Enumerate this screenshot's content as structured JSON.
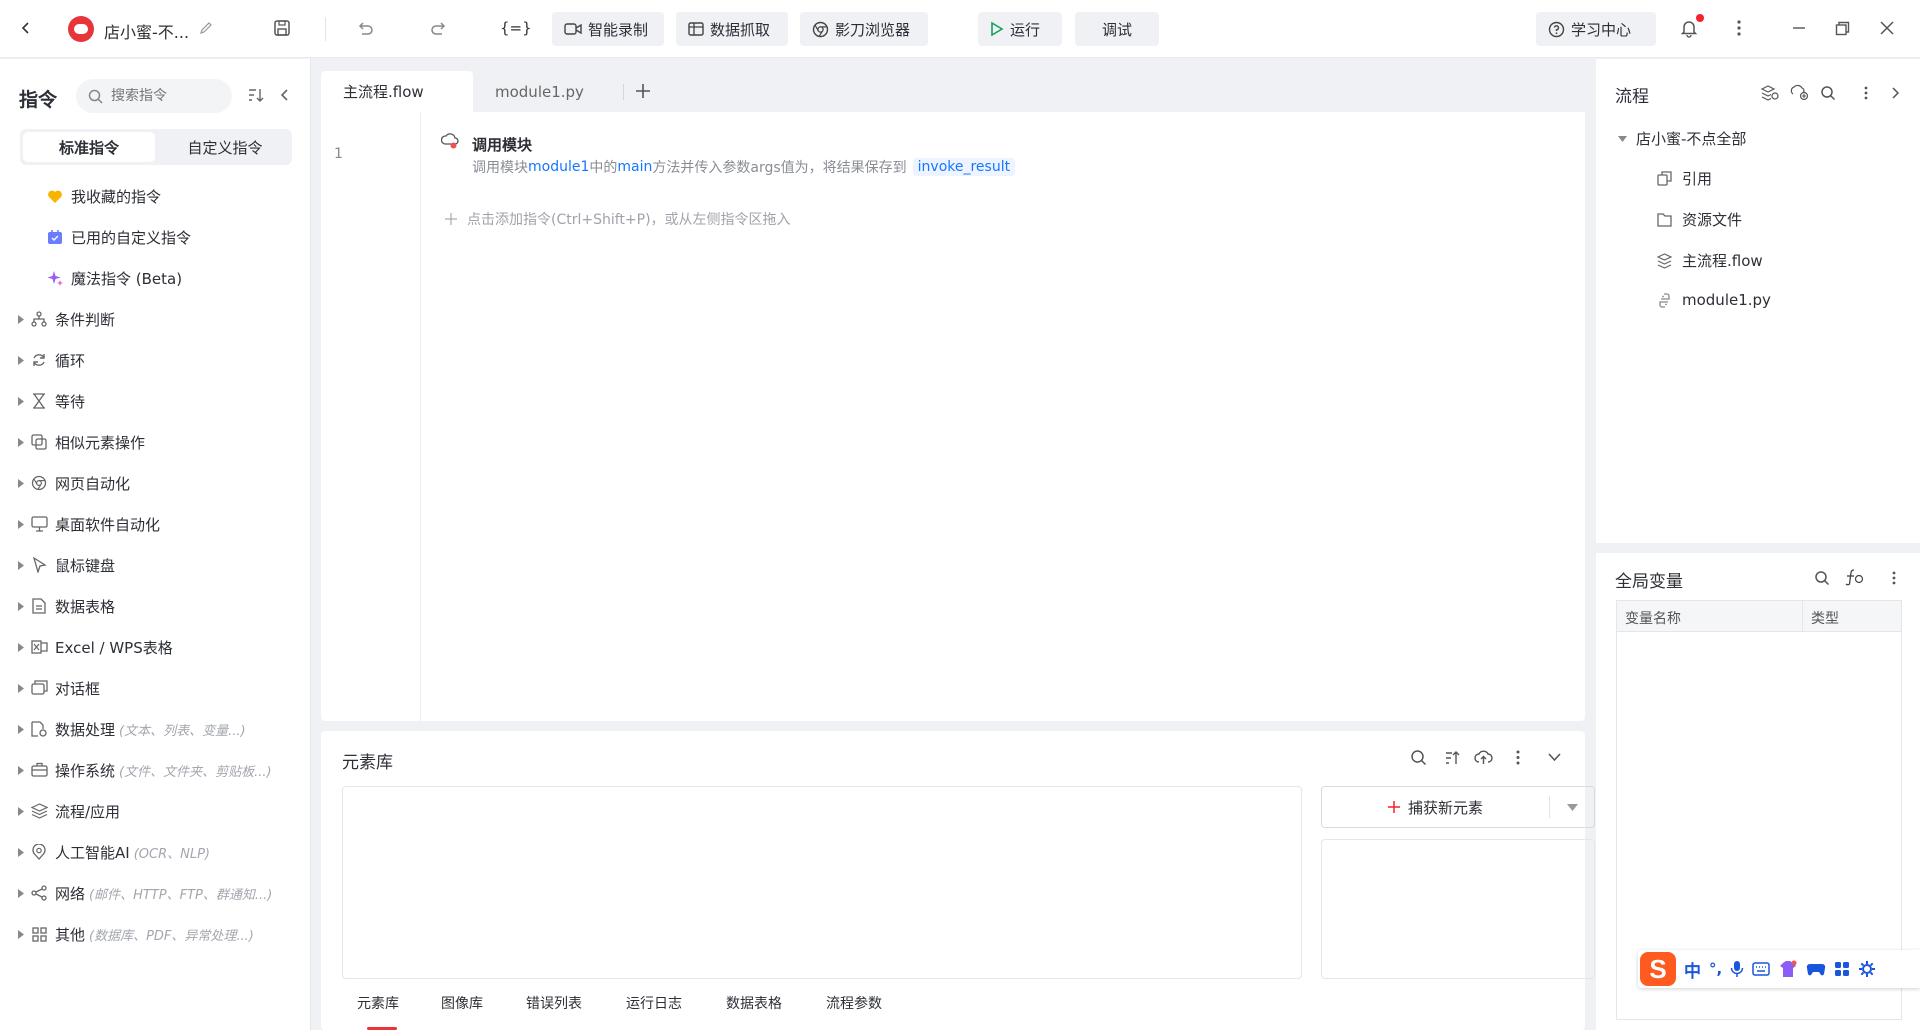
{
  "header": {
    "project_name": "店小蜜-不...",
    "record_label": "智能录制",
    "scrape_label": "数据抓取",
    "browser_label": "影刀浏览器",
    "run_label": "运行",
    "debug_label": "调试",
    "learn_label": "学习中心",
    "code_glyph": "{=}"
  },
  "left_panel": {
    "title": "指令",
    "search_placeholder": "搜索指令",
    "tab_standard": "标准指令",
    "tab_custom": "自定义指令",
    "items": [
      {
        "label": "我收藏的指令",
        "hint": ""
      },
      {
        "label": "已用的自定义指令",
        "hint": ""
      },
      {
        "label": "魔法指令 (Beta)",
        "hint": ""
      },
      {
        "label": "条件判断",
        "hint": ""
      },
      {
        "label": "循环",
        "hint": ""
      },
      {
        "label": "等待",
        "hint": ""
      },
      {
        "label": "相似元素操作",
        "hint": ""
      },
      {
        "label": "网页自动化",
        "hint": ""
      },
      {
        "label": "桌面软件自动化",
        "hint": ""
      },
      {
        "label": "鼠标键盘",
        "hint": ""
      },
      {
        "label": "数据表格",
        "hint": ""
      },
      {
        "label": "Excel / WPS表格",
        "hint": ""
      },
      {
        "label": "对话框",
        "hint": ""
      },
      {
        "label": "数据处理",
        "hint": "(文本、列表、变量...)"
      },
      {
        "label": "操作系统",
        "hint": "(文件、文件夹、剪贴板...)"
      },
      {
        "label": "流程/应用",
        "hint": ""
      },
      {
        "label": "人工智能AI",
        "hint": "(OCR、NLP)"
      },
      {
        "label": "网络",
        "hint": "(邮件、HTTP、FTP、群通知...)"
      },
      {
        "label": "其他",
        "hint": "(数据库、PDF、异常处理...)"
      }
    ]
  },
  "editor": {
    "tabs": [
      "主流程.flow",
      "module1.py"
    ],
    "line_number": "1",
    "cmd_title": "调用模块",
    "cmd_p1": "调用模块",
    "cmd_module": "module1",
    "cmd_p2": "中的",
    "cmd_method": "main",
    "cmd_p3": "方法并传入参数args值为，将结果保存到",
    "cmd_var": "invoke_result",
    "add_hint": "点击添加指令(Ctrl+Shift+P)，或从左侧指令区拖入"
  },
  "element_lib": {
    "title": "元素库",
    "capture_label": "捕获新元素",
    "bottom_tabs": [
      "元素库",
      "图像库",
      "错误列表",
      "运行日志",
      "数据表格",
      "流程参数"
    ]
  },
  "flow_panel": {
    "title": "流程",
    "root": "店小蜜-不点全部",
    "items": [
      "引用",
      "资源文件",
      "主流程.flow",
      "module1.py"
    ]
  },
  "vars_panel": {
    "title": "全局变量",
    "col_name": "变量名称",
    "col_type": "类型"
  },
  "ime": {
    "items": [
      "中",
      "°,"
    ]
  },
  "colors": {
    "accent": "#1677ff",
    "run_green": "#18a058",
    "brand_red": "#e6353b",
    "active_tab_bg": "#f0f1f4"
  }
}
